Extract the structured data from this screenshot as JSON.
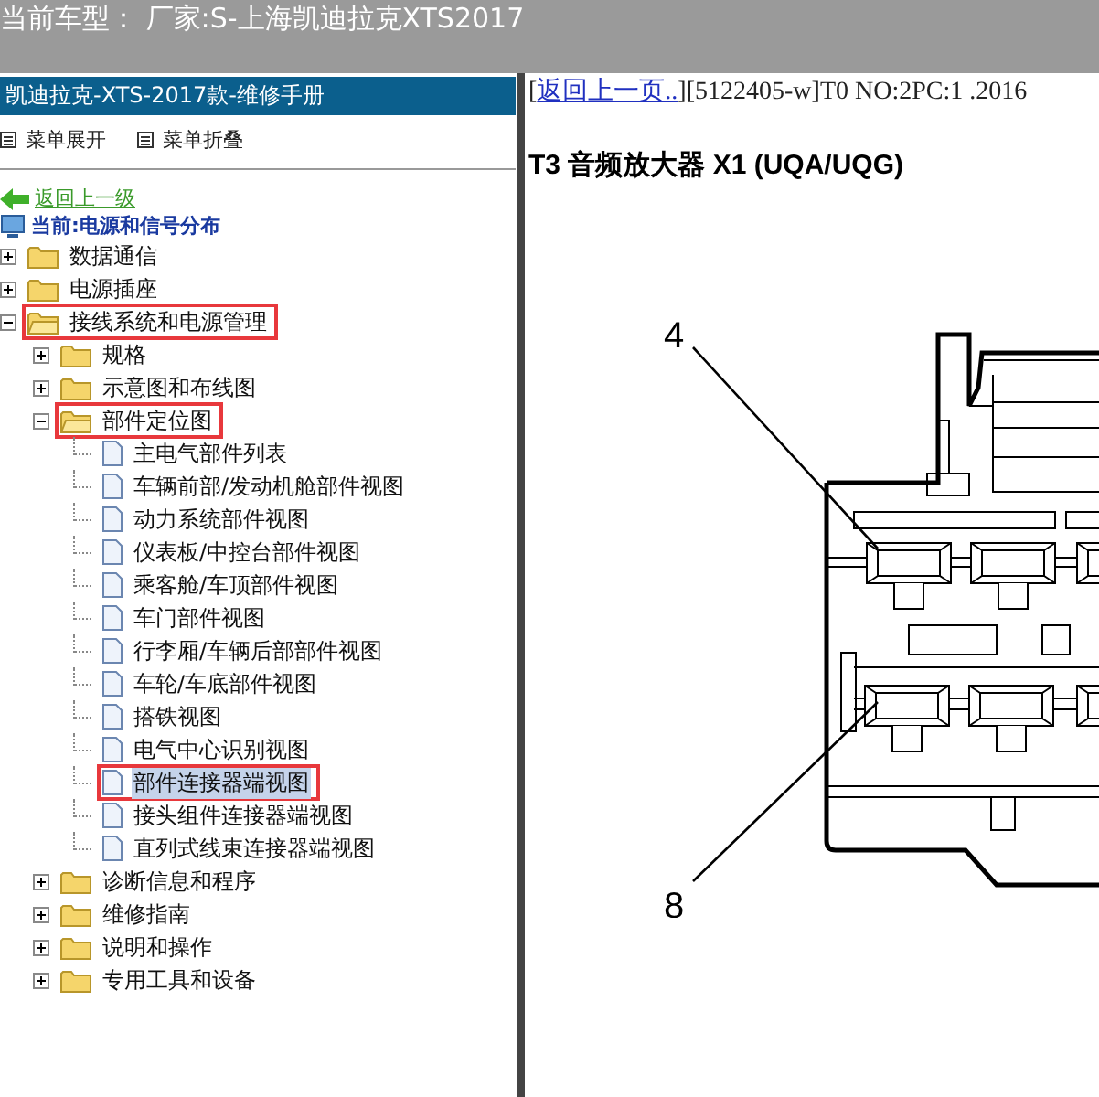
{
  "top_bar": {
    "title": "当前车型： 厂家:S-上海凯迪拉克XTS2017"
  },
  "sidebar": {
    "header": "凯迪拉克-XTS-2017款-维修手册",
    "menu": [
      "菜单展开",
      "菜单折叠"
    ],
    "back_link": "返回上一级",
    "current": "当前:电源和信号分布",
    "tree": [
      {
        "label": "数据通信",
        "kind": "folder",
        "expanded": false,
        "highlighted": false,
        "selected": false
      },
      {
        "label": "电源插座",
        "kind": "folder",
        "expanded": false,
        "highlighted": false,
        "selected": false
      },
      {
        "label": "接线系统和电源管理",
        "kind": "folder",
        "expanded": true,
        "highlighted": true,
        "selected": false,
        "children": [
          {
            "label": "规格",
            "kind": "folder",
            "expanded": false,
            "highlighted": false,
            "selected": false
          },
          {
            "label": "示意图和布线图",
            "kind": "folder",
            "expanded": false,
            "highlighted": false,
            "selected": false
          },
          {
            "label": "部件定位图",
            "kind": "folder",
            "expanded": true,
            "highlighted": true,
            "selected": false,
            "children": [
              {
                "label": "主电气部件列表",
                "kind": "page",
                "highlighted": false,
                "selected": false
              },
              {
                "label": "车辆前部/发动机舱部件视图",
                "kind": "page",
                "highlighted": false,
                "selected": false
              },
              {
                "label": "动力系统部件视图",
                "kind": "page",
                "highlighted": false,
                "selected": false
              },
              {
                "label": "仪表板/中控台部件视图",
                "kind": "page",
                "highlighted": false,
                "selected": false
              },
              {
                "label": "乘客舱/车顶部件视图",
                "kind": "page",
                "highlighted": false,
                "selected": false
              },
              {
                "label": "车门部件视图",
                "kind": "page",
                "highlighted": false,
                "selected": false
              },
              {
                "label": "行李厢/车辆后部部件视图",
                "kind": "page",
                "highlighted": false,
                "selected": false
              },
              {
                "label": "车轮/车底部件视图",
                "kind": "page",
                "highlighted": false,
                "selected": false
              },
              {
                "label": "搭铁视图",
                "kind": "page",
                "highlighted": false,
                "selected": false
              },
              {
                "label": "电气中心识别视图",
                "kind": "page",
                "highlighted": false,
                "selected": false
              },
              {
                "label": "部件连接器端视图",
                "kind": "page",
                "highlighted": true,
                "selected": true
              },
              {
                "label": "接头组件连接器端视图",
                "kind": "page",
                "highlighted": false,
                "selected": false
              },
              {
                "label": "直列式线束连接器端视图",
                "kind": "page",
                "highlighted": false,
                "selected": false
              }
            ]
          },
          {
            "label": "诊断信息和程序",
            "kind": "folder",
            "expanded": false,
            "highlighted": false,
            "selected": false
          },
          {
            "label": "维修指南",
            "kind": "folder",
            "expanded": false,
            "highlighted": false,
            "selected": false
          },
          {
            "label": "说明和操作",
            "kind": "folder",
            "expanded": false,
            "highlighted": false,
            "selected": false
          },
          {
            "label": "专用工具和设备",
            "kind": "folder",
            "expanded": false,
            "highlighted": false,
            "selected": false
          }
        ]
      }
    ]
  },
  "content": {
    "bracket_open": "[",
    "back_link": "返回上一页..",
    "bracket_close": "]",
    "doc_info": "[5122405-w]T0 NO:2PC:1 .2016",
    "title": "T3 音频放大器 X1 (UQA/UQG)",
    "callouts": [
      "4",
      "8"
    ]
  }
}
